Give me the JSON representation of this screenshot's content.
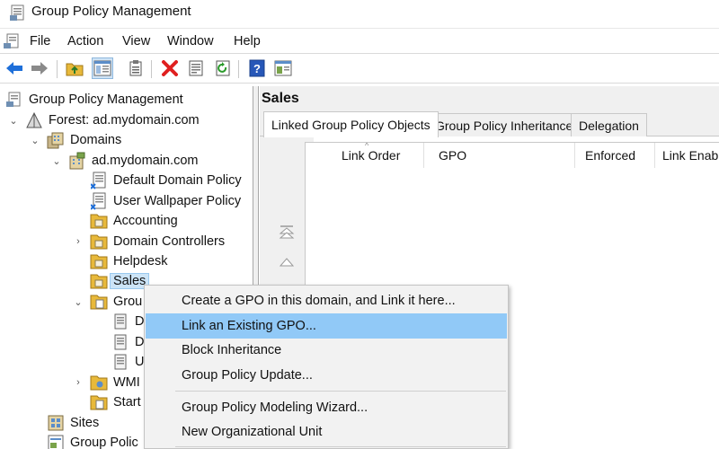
{
  "window": {
    "title": "Group Policy Management"
  },
  "menu": [
    "File",
    "Action",
    "View",
    "Window",
    "Help"
  ],
  "toolbar": [
    "back-icon",
    "forward-icon",
    "up-folder-icon",
    "show-hide-tree-icon",
    "properties-icon",
    "delete-icon",
    "export-list-icon",
    "refresh-icon",
    "help-icon",
    "console-icon"
  ],
  "tree": {
    "root": "Group Policy Management",
    "forest": "Forest: ad.mydomain.com",
    "domains": "Domains",
    "domain": "ad.mydomain.com",
    "items": [
      "Default Domain Policy",
      "User Wallpaper Policy",
      "Accounting",
      "Domain Controllers",
      "Helpdesk",
      "Sales",
      "Grou",
      "D",
      "D",
      "U",
      "WMI",
      "Start",
      "Sites",
      "Group Polic"
    ]
  },
  "right": {
    "title": "Sales",
    "tabs": [
      "Linked Group Policy Objects",
      "Group Policy Inheritance",
      "Delegation"
    ],
    "columns": [
      "Link Order",
      "GPO",
      "Enforced",
      "Link Enable"
    ]
  },
  "context_menu": {
    "items": [
      "Create a GPO in this domain, and Link it here...",
      "Link an Existing GPO...",
      "Block Inheritance",
      "Group Policy Update...",
      "Group Policy Modeling Wizard...",
      "New Organizational Unit"
    ],
    "highlighted": "Link an Existing GPO..."
  },
  "colors": {
    "highlight": "#91c9f7",
    "selection": "#cce4f7",
    "accent_blue": "#1e6fd9",
    "delete_red": "#e02020"
  }
}
